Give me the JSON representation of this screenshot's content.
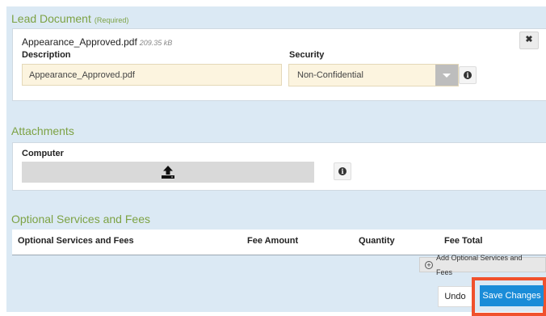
{
  "lead_document": {
    "title": "Lead Document",
    "required_tag": "(Required)",
    "file_name": "Appearance_Approved.pdf",
    "file_size": "209.35 kB",
    "remove_label": "✖",
    "description_label": "Description",
    "description_value": "Appearance_Approved.pdf",
    "security_label": "Security",
    "security_value": "Non-Confidential"
  },
  "attachments": {
    "title": "Attachments",
    "computer_label": "Computer"
  },
  "optional_services": {
    "title": "Optional Services and Fees",
    "columns": [
      "Optional Services and Fees",
      "Fee Amount",
      "Quantity",
      "Fee Total"
    ],
    "add_button_label": "Add Optional Services and Fees"
  },
  "actions": {
    "undo_label": "Undo",
    "save_label": "Save Changes"
  },
  "info_glyph": "i",
  "colors": {
    "panel_bg": "#dbe9f4",
    "section_title": "#7da244",
    "input_bg": "#fcf4df",
    "save_button": "#1a8cd8",
    "highlight": "#f0512d"
  }
}
